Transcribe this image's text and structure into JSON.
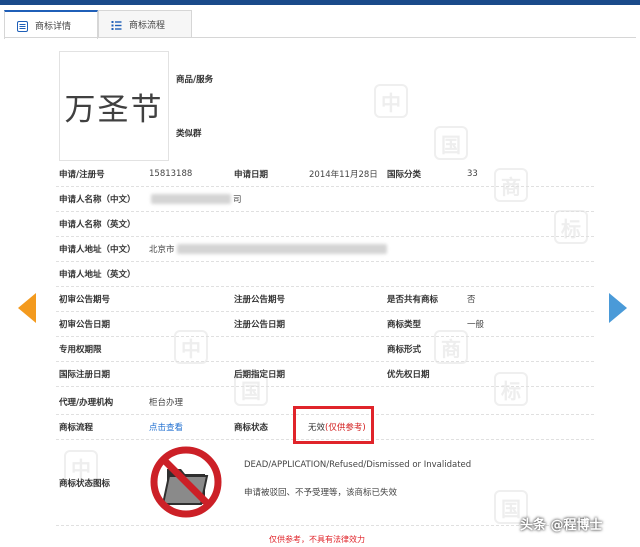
{
  "topbar": {
    "text": "— ·· —— · · ——"
  },
  "tabs": [
    {
      "label": "商标详情",
      "icon": "document-icon",
      "active": true
    },
    {
      "label": "商标流程",
      "icon": "list-icon",
      "active": false
    }
  ],
  "watermark": {
    "chars": [
      "中",
      "国",
      "商",
      "标"
    ]
  },
  "trademark": {
    "logo_text": "万圣节",
    "goods_label": "商品/服务",
    "similar_group_label": "类似群"
  },
  "fields": {
    "reg_no_label": "申请/注册号",
    "reg_no": "15813188",
    "apply_date_label": "申请日期",
    "apply_date": "2014年11月28日",
    "intl_class_label": "国际分类",
    "intl_class": "33",
    "applicant_cn_label": "申请人名称（中文）",
    "applicant_cn_tail": "司",
    "applicant_en_label": "申请人名称（英文）",
    "address_cn_label": "申请人地址（中文）",
    "address_cn_prefix": "北京市",
    "address_en_label": "申请人地址（英文）",
    "prelim_pub_no_label": "初审公告期号",
    "reg_pub_no_label": "注册公告期号",
    "shared_label": "是否共有商标",
    "shared_value": "否",
    "prelim_pub_date_label": "初审公告日期",
    "reg_pub_date_label": "注册公告日期",
    "tm_type_label": "商标类型",
    "tm_type_value": "一般",
    "exclusive_period_label": "专用权期限",
    "tm_form_label": "商标形式",
    "intl_reg_date_label": "国际注册日期",
    "later_designation_label": "后期指定日期",
    "priority_date_label": "优先权日期",
    "agent_label": "代理/办理机构",
    "agent_value": "柜台办理",
    "process_label": "商标流程",
    "process_link": "点击查看",
    "status_label": "商标状态",
    "status_value": "无效",
    "status_ref": "(仅供参考)",
    "status_icon_label": "商标状态图标",
    "status_en": "DEAD/APPLICATION/Refused/Dismissed or Invalidated",
    "status_cn": "申请被驳回、不予受理等，该商标已失效"
  },
  "footnote": "仅供参考，不具有法律效力",
  "credit": "头条 @程博士",
  "colors": {
    "accent": "#1f5fb8",
    "alert": "#e0242a",
    "prev": "#f39a1e",
    "next": "#4a9ad8"
  }
}
